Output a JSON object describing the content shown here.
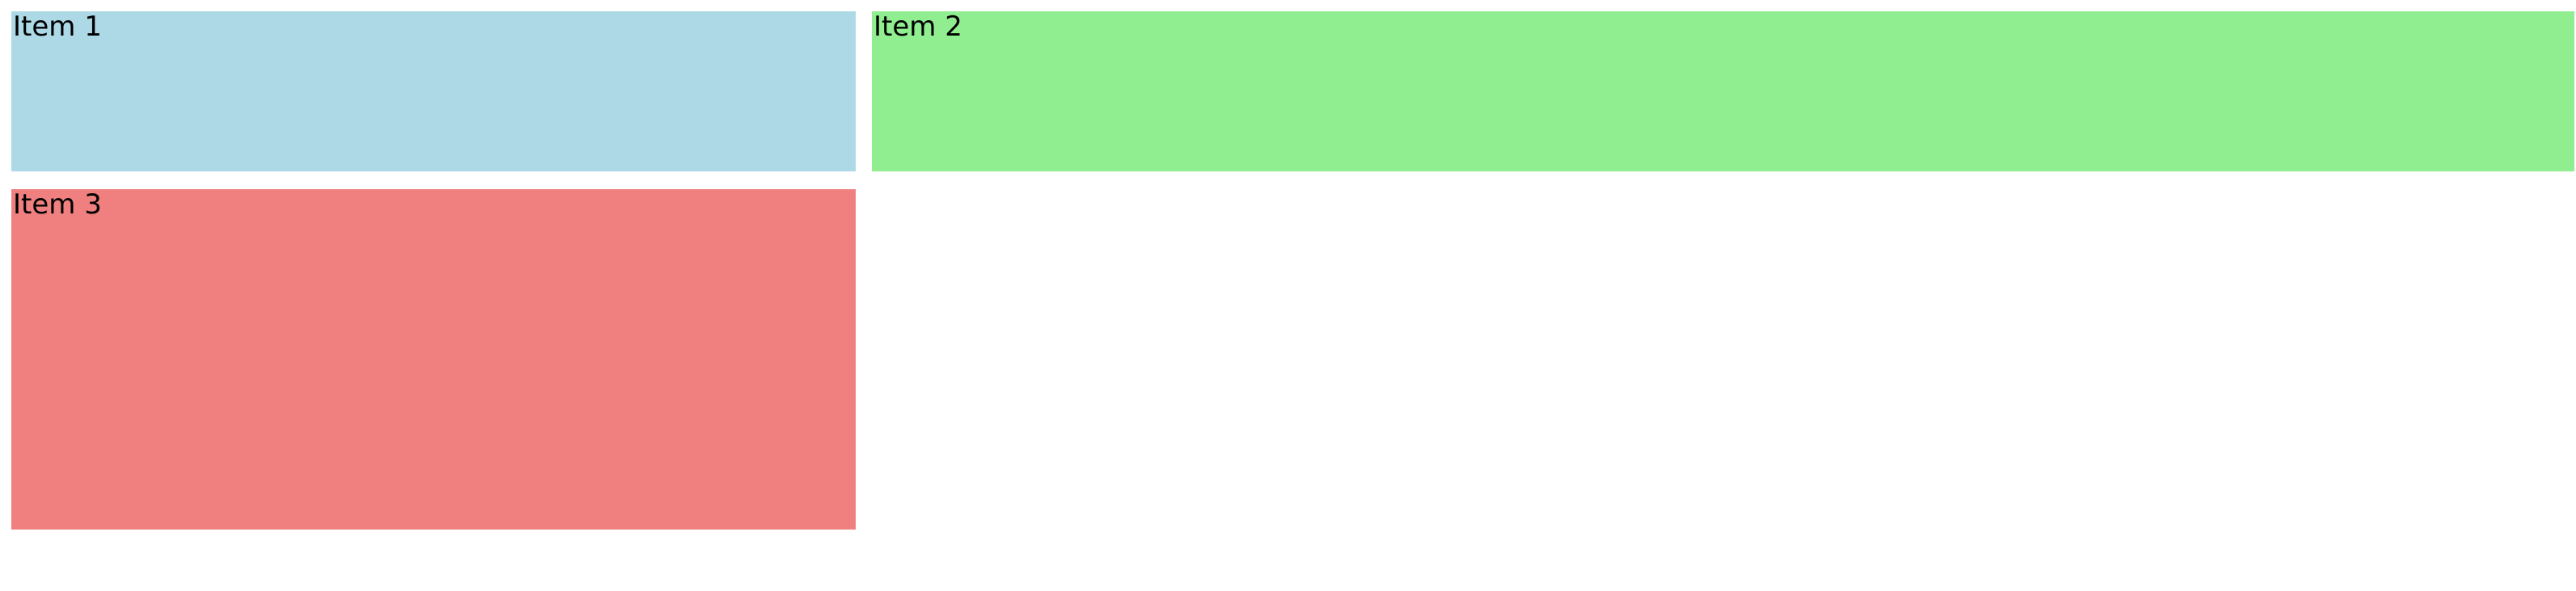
{
  "grid": {
    "items": [
      {
        "label": "Item 1",
        "color": "#add8e6"
      },
      {
        "label": "Item 2",
        "color": "#90ee90"
      },
      {
        "label": "Item 3",
        "color": "#f08080"
      }
    ]
  }
}
